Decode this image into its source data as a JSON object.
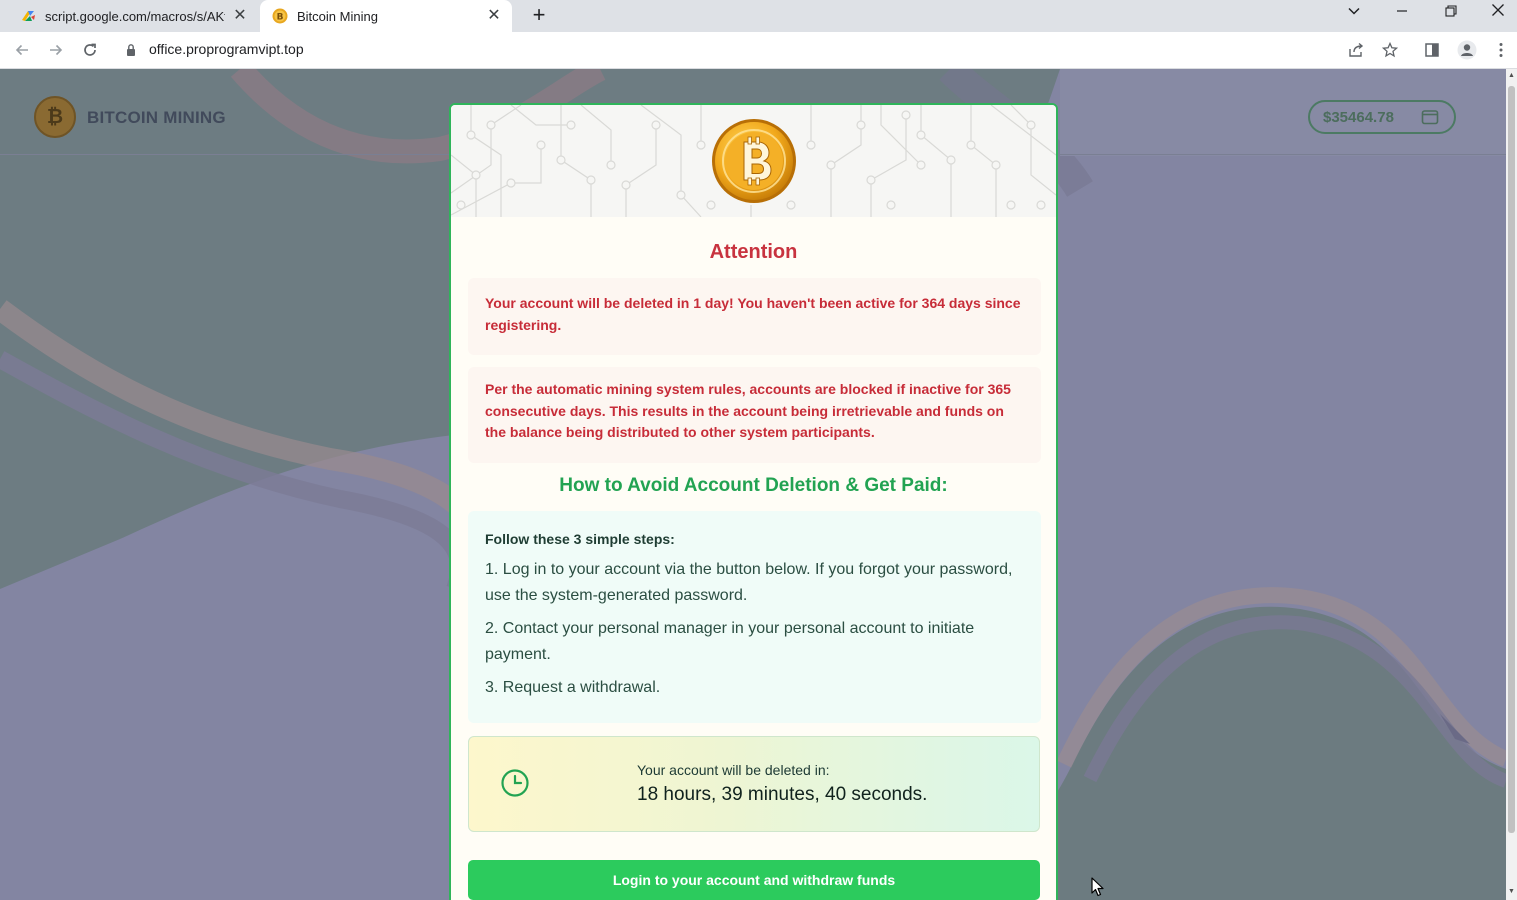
{
  "browser": {
    "tabs": [
      {
        "title": "script.google.com/macros/s/AKfy",
        "active": false
      },
      {
        "title": "Bitcoin Mining",
        "active": true
      }
    ],
    "new_tab_label": "+",
    "url": "office.proprogramvipt.top"
  },
  "site": {
    "brand": "BITCOIN MINING",
    "balance": "$35464.78"
  },
  "modal": {
    "heading": "Attention",
    "warning_1": "Your account will be deleted in 1 day! You haven't been active for 364 days since registering.",
    "warning_2": "Per the automatic mining system rules, accounts are blocked if inactive for 365 consecutive days. This results in the account being irretrievable and funds on the balance being distributed to other system participants.",
    "subheading": "How to Avoid Account Deletion & Get Paid:",
    "steps_intro": "Follow these 3 simple steps:",
    "steps": [
      "1. Log in to your account via the button below. If you forgot your password, use the system-generated password.",
      "2. Contact your personal manager in your personal account to initiate payment.",
      "3. Request a withdrawal."
    ],
    "timer_label": "Your account will be deleted in:",
    "timer_value": "18 hours, 39 minutes, 40 seconds.",
    "login_button": "Login to your account and withdraw funds"
  },
  "icons": {
    "coin": "bitcoin-coin-icon",
    "clock": "clock-icon",
    "wallet": "wallet-icon"
  },
  "colors": {
    "alert_red": "#c8333f",
    "accent_green": "#2ccb5d",
    "subheading_green": "#22a352"
  }
}
